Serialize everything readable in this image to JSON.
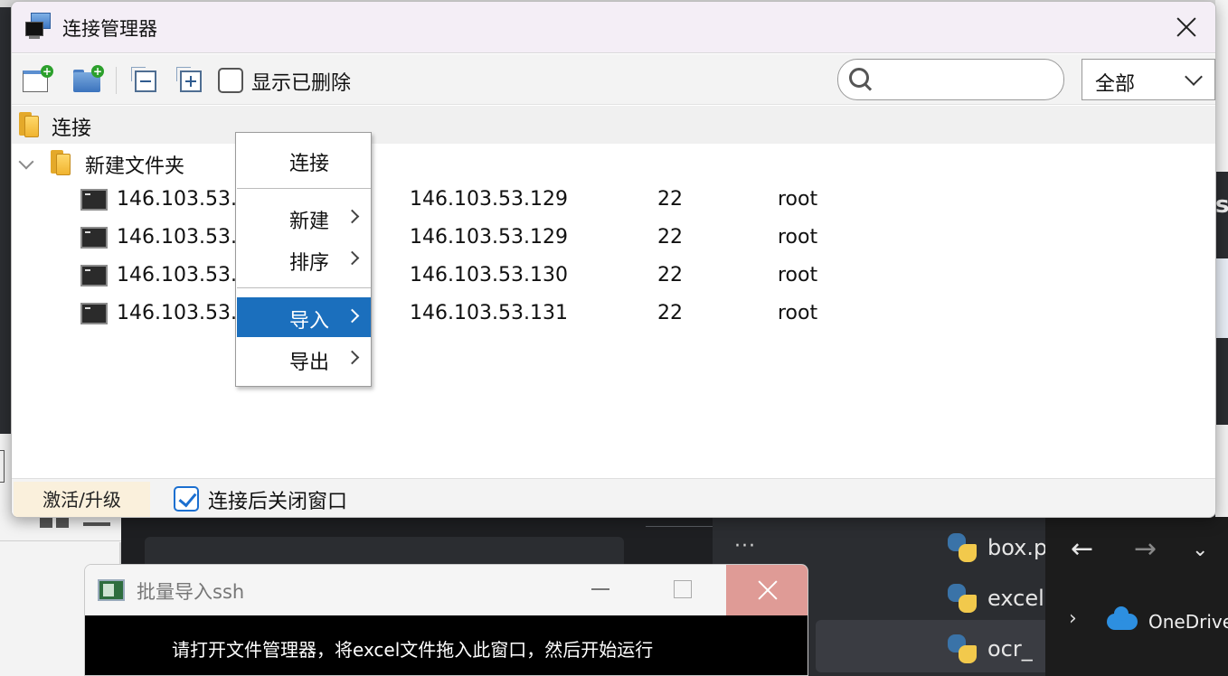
{
  "window": {
    "title": "连接管理器"
  },
  "toolbar": {
    "show_deleted_label": "显示已删除",
    "search_placeholder": "",
    "filter_value": "全部"
  },
  "tree": {
    "root_label": "连接",
    "folder_label": "新建文件夹",
    "connections": [
      {
        "name": "146.103.53.",
        "host": "146.103.53.129",
        "port": "22",
        "user": "root"
      },
      {
        "name": "146.103.53.",
        "host": "146.103.53.129",
        "port": "22",
        "user": "root"
      },
      {
        "name": "146.103.53.",
        "host": "146.103.53.130",
        "port": "22",
        "user": "root"
      },
      {
        "name": "146.103.53.",
        "host": "146.103.53.131",
        "port": "22",
        "user": "root"
      }
    ]
  },
  "context_menu": {
    "items": [
      {
        "label": "连接"
      },
      {
        "label": "新建"
      },
      {
        "label": "排序"
      },
      {
        "label": "导入"
      },
      {
        "label": "导出"
      }
    ]
  },
  "footer": {
    "upgrade_label": "激活/升级",
    "close_after_connect_label": "连接后关闭窗口"
  },
  "batch_window": {
    "title": "批量导入ssh",
    "message": "请打开文件管理器，将excel文件拖入此窗口，然后开始运行"
  },
  "background": {
    "files": [
      "box.p",
      "excel",
      "ocr_"
    ],
    "dots": "···",
    "onedrive_label": "OneDrive",
    "right_edge_char": "s"
  },
  "colors": {
    "menu_highlight": "#1b6fbd",
    "checkbox_accent": "#1b6fd0",
    "upgrade_bg": "#faf0dc"
  }
}
